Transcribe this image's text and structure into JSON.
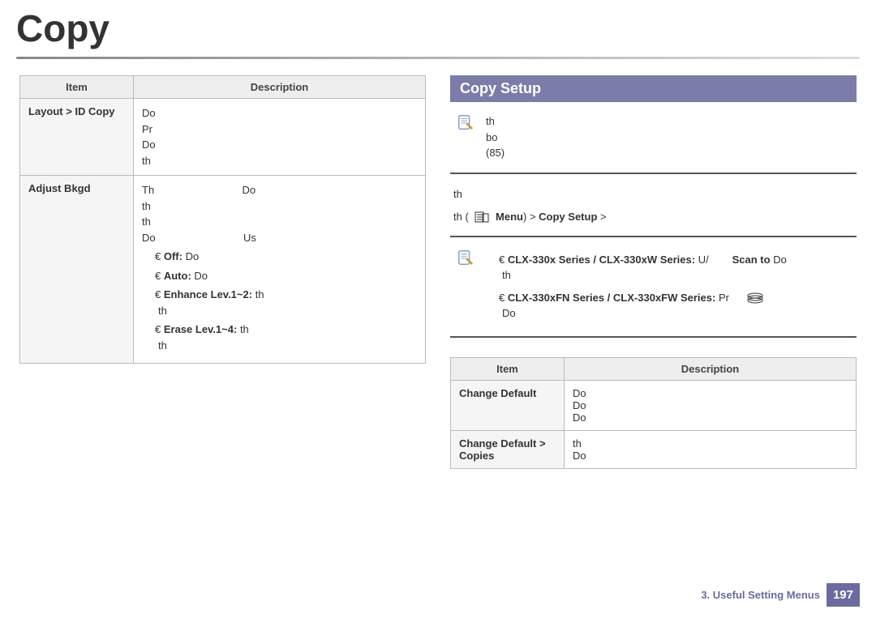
{
  "title": "Copy",
  "left_table": {
    "headers": [
      "Item",
      "Description"
    ],
    "rows": [
      {
        "item": "Layout > ID Copy",
        "desc_lines": [
          "Do",
          "Pr",
          "Do",
          "th"
        ]
      },
      {
        "item": "Adjust Bkgd",
        "intro_lines": [
          "Th",
          "th",
          "Do",
          "th",
          "Do",
          "Us"
        ],
        "bullets": [
          {
            "label": "Off:",
            "text": "Do"
          },
          {
            "label": "Auto:",
            "text": "Do"
          },
          {
            "label": "Enhance Lev.1~2:",
            "text": "th",
            "extra": "th"
          },
          {
            "label": "Erase Lev.1~4:",
            "text": "th",
            "extra": "th"
          }
        ]
      }
    ]
  },
  "right": {
    "section_title": "Copy Setup",
    "note_lines": [
      "th",
      "bo",
      "(85)"
    ],
    "instr_pre": "th",
    "instr_line": "th (            Menu) > Copy Setup >",
    "series_block": [
      {
        "label": "CLX-330x Series / CLX-330xW Series:",
        "mid": "U/",
        "right": "Scan to",
        "after": "Do",
        "extra": "th"
      },
      {
        "label": "CLX-330xFN Series / CLX-330xFW Series:",
        "mid": "Pr",
        "right": "",
        "after": "Do",
        "extra": ""
      }
    ],
    "table": {
      "headers": [
        "Item",
        "Description"
      ],
      "rows": [
        {
          "item": "Change Default",
          "desc_lines": [
            "Do",
            "Do",
            "Do"
          ]
        },
        {
          "item": "Change Default > Copies",
          "desc_lines": [
            "th",
            "Do"
          ]
        }
      ]
    }
  },
  "footer": {
    "chapter": "3.  Useful Setting Menus",
    "page": "197"
  }
}
